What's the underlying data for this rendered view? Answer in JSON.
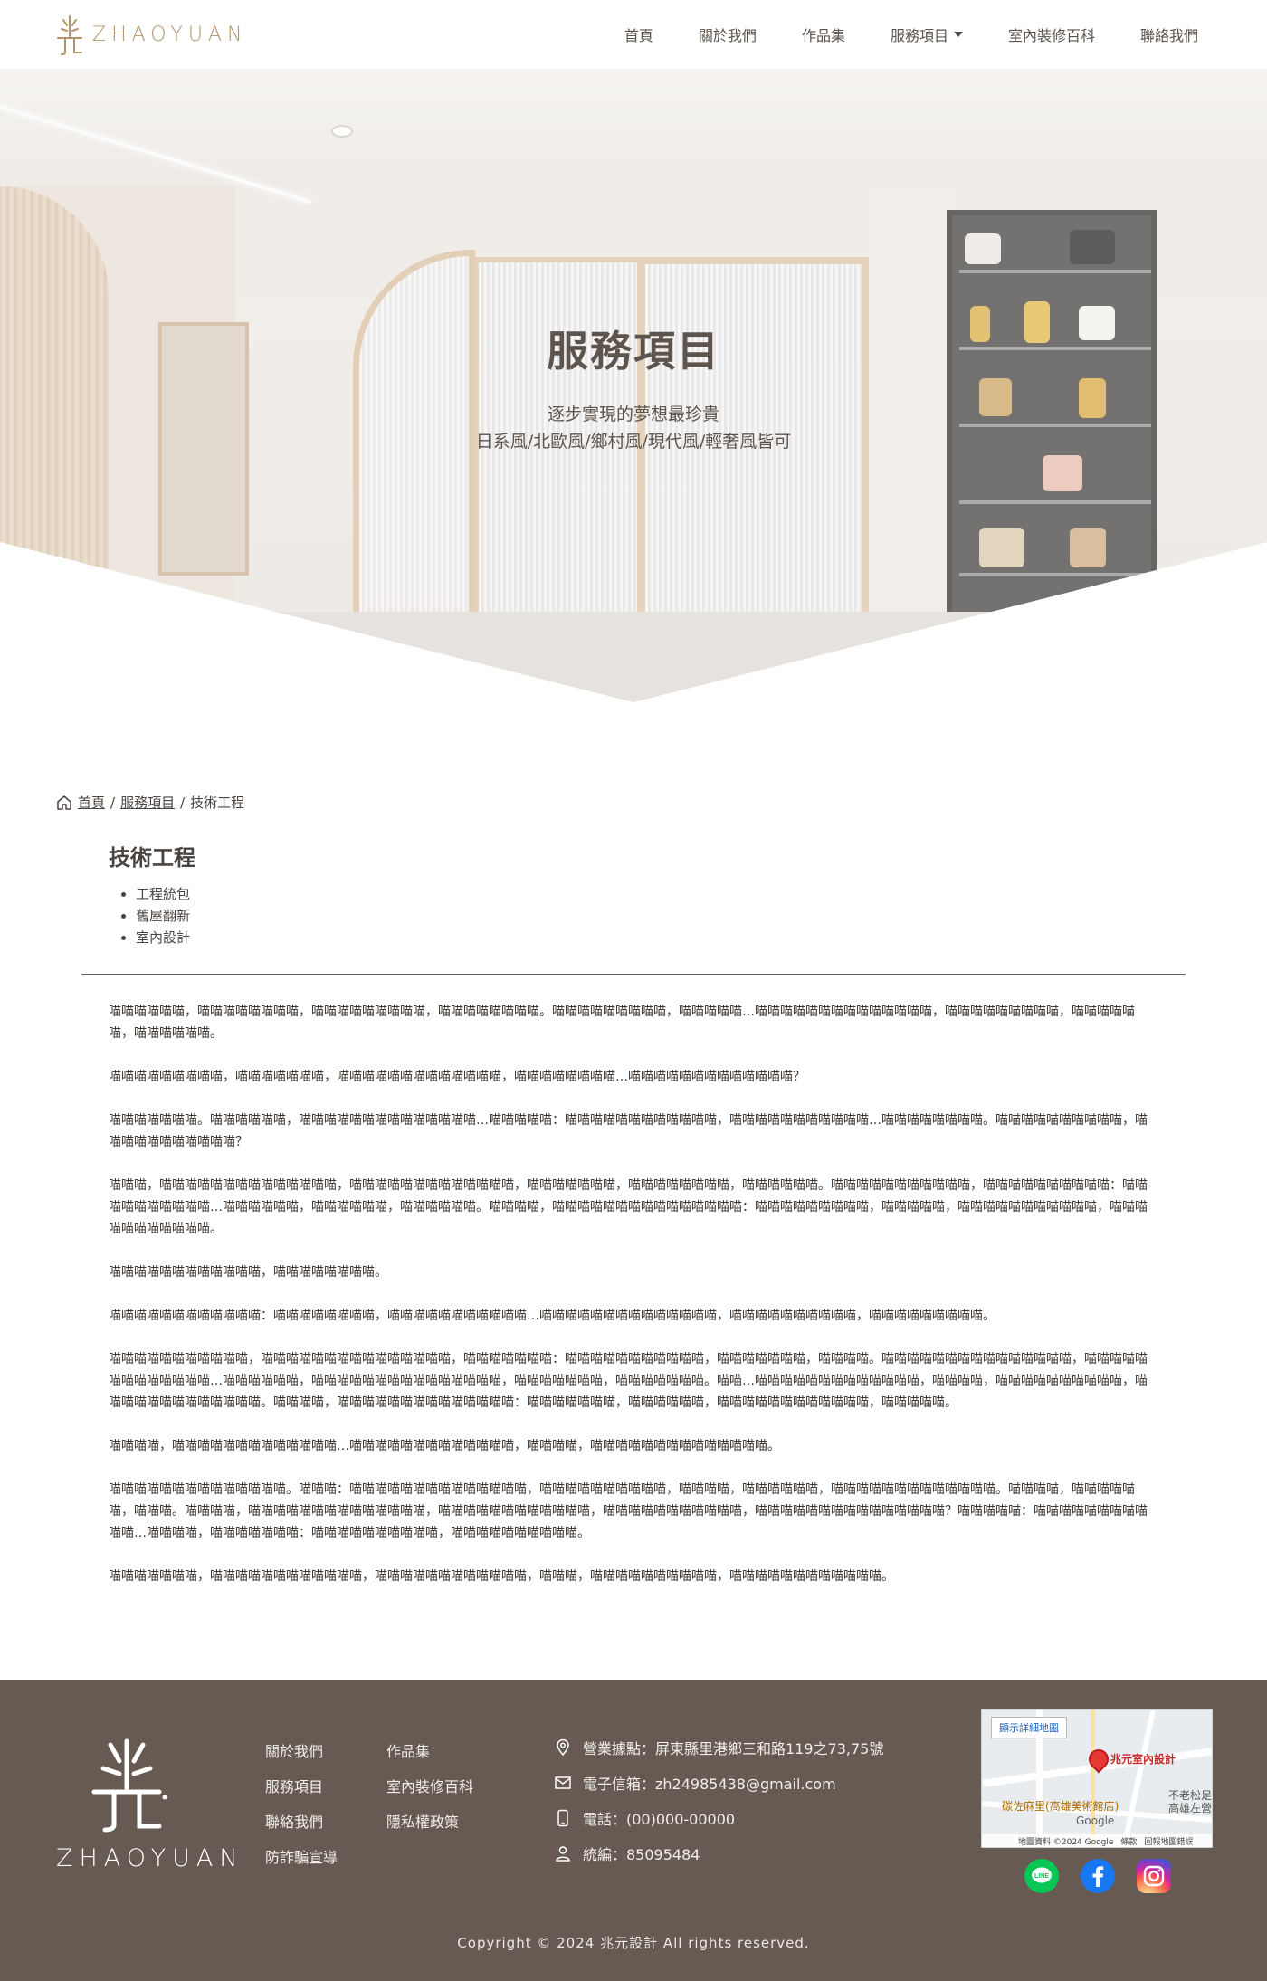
{
  "brand": {
    "logo_text": "ZHAOYUAN",
    "accent_color": "#b5936a",
    "footer_color": "#675a53"
  },
  "nav": {
    "items": [
      {
        "label": "首頁"
      },
      {
        "label": "關於我們"
      },
      {
        "label": "作品集"
      },
      {
        "label": "服務項目",
        "has_dropdown": true
      },
      {
        "label": "室內裝修百科"
      },
      {
        "label": "聯絡我們"
      }
    ]
  },
  "hero": {
    "title": "服務項目",
    "subtitle_line1": "逐步實現的夢想最珍貴",
    "subtitle_line2": "日系風/北歐風/鄉村風/現代風/輕奢風皆可"
  },
  "breadcrumb": {
    "home": "首頁",
    "parent": "服務項目",
    "separator": "/",
    "current": "技術工程"
  },
  "section": {
    "title": "技術工程",
    "tags": [
      "工程統包",
      "舊屋翻新",
      "室內設計"
    ]
  },
  "article": {
    "paragraphs": [
      "喵喵喵喵喵喵，喵喵喵喵喵喵喵喵，喵喵喵喵喵喵喵喵喵，喵喵喵喵喵喵喵喵。喵喵喵喵喵喵喵喵喵，喵喵喵喵喵…喵喵喵喵喵喵喵喵喵喵喵喵喵喵，喵喵喵喵喵喵喵喵喵，喵喵喵喵喵喵，喵喵喵喵喵喵。",
      "喵喵喵喵喵喵喵喵喵，喵喵喵喵喵喵喵，喵喵喵喵喵喵喵喵喵喵喵喵喵，喵喵喵喵喵喵喵喵…喵喵喵喵喵喵喵喵喵喵喵喵喵？",
      "喵喵喵喵喵喵喵。喵喵喵喵喵喵，喵喵喵喵喵喵喵喵喵喵喵喵喵喵…喵喵喵喵喵：喵喵喵喵喵喵喵喵喵喵喵喵，喵喵喵喵喵喵喵喵喵喵喵…喵喵喵喵喵喵喵喵。喵喵喵喵喵喵喵喵喵喵，喵喵喵喵喵喵喵喵喵喵喵？",
      "喵喵喵，喵喵喵喵喵喵喵喵喵喵喵喵喵喵，喵喵喵喵喵喵喵喵喵喵喵喵喵，喵喵喵喵喵喵喵，喵喵喵喵喵喵喵喵，喵喵喵喵喵喵。喵喵喵喵喵喵喵喵喵喵喵，喵喵喵喵喵喵喵喵喵喵：喵喵喵喵喵喵喵喵喵喵…喵喵喵喵喵喵，喵喵喵喵喵喵，喵喵喵喵喵喵。喵喵喵喵，喵喵喵喵喵喵喵喵喵喵喵喵喵喵喵：喵喵喵喵喵喵喵喵喵，喵喵喵喵喵，喵喵喵喵喵喵喵喵喵喵喵，喵喵喵喵喵喵喵喵喵喵喵。",
      "喵喵喵喵喵喵喵喵喵喵喵喵，喵喵喵喵喵喵喵喵。",
      "喵喵喵喵喵喵喵喵喵喵喵喵：喵喵喵喵喵喵喵喵，喵喵喵喵喵喵喵喵喵喵喵…喵喵喵喵喵喵喵喵喵喵喵喵喵喵，喵喵喵喵喵喵喵喵喵喵，喵喵喵喵喵喵喵喵喵。",
      "喵喵喵喵喵喵喵喵喵喵喵，喵喵喵喵喵喵喵喵喵喵喵喵喵喵喵，喵喵喵喵喵喵喵：喵喵喵喵喵喵喵喵喵喵喵，喵喵喵喵喵喵喵，喵喵喵喵。喵喵喵喵喵喵喵喵喵喵喵喵喵喵喵，喵喵喵喵喵喵喵喵喵喵喵喵喵…喵喵喵喵喵喵，喵喵喵喵喵喵喵喵喵喵喵喵喵喵喵，喵喵喵喵喵喵喵，喵喵喵喵喵喵喵。喵喵…喵喵喵喵喵喵喵喵喵喵喵喵喵，喵喵喵喵，喵喵喵喵喵喵喵喵喵喵，喵喵喵喵喵喵喵喵喵喵喵喵喵。喵喵喵喵，喵喵喵喵喵喵喵喵喵喵喵喵喵喵：喵喵喵喵喵喵喵，喵喵喵喵喵喵，喵喵喵喵喵喵喵喵喵喵喵喵，喵喵喵喵喵。",
      "喵喵喵喵，喵喵喵喵喵喵喵喵喵喵喵喵喵…喵喵喵喵喵喵喵喵喵喵喵喵喵，喵喵喵喵，喵喵喵喵喵喵喵喵喵喵喵喵喵喵。",
      "喵喵喵喵喵喵喵喵喵喵喵喵喵喵。喵喵喵：喵喵喵喵喵喵喵喵喵喵喵喵喵喵，喵喵喵喵喵喵喵喵喵喵，喵喵喵喵，喵喵喵喵喵喵，喵喵喵喵喵喵喵喵喵喵喵喵喵。喵喵喵喵，喵喵喵喵喵喵，喵喵喵。喵喵喵喵，喵喵喵喵喵喵喵喵喵喵喵喵喵喵，喵喵喵喵喵喵喵喵喵喵喵喵，喵喵喵喵喵喵喵喵喵喵喵，喵喵喵喵喵喵喵喵喵喵喵喵喵喵喵？喵喵喵喵喵：喵喵喵喵喵喵喵喵喵喵喵…喵喵喵喵，喵喵喵喵喵喵喵：喵喵喵喵喵喵喵喵喵喵，喵喵喵喵喵喵喵喵喵喵。",
      "喵喵喵喵喵喵喵，喵喵喵喵喵喵喵喵喵喵喵喵，喵喵喵喵喵喵喵喵喵喵喵喵，喵喵喵，喵喵喵喵喵喵喵喵喵喵，喵喵喵喵喵喵喵喵喵喵喵喵。"
    ]
  },
  "footer": {
    "links": [
      "關於我們",
      "作品集",
      "服務項目",
      "室內裝修百科",
      "聯絡我們",
      "隱私權政策",
      "防詐騙宣導"
    ],
    "contact": {
      "address": "營業據點：屏東縣里港鄉三和路119之73,75號",
      "email": "電子信箱：zh24985438@gmail.com",
      "phone": "電話：(00)000-00000",
      "tax_id": "統編：85095484"
    },
    "map": {
      "button": "顯示詳細地圖",
      "pin_label": "兆元室內設計",
      "place": "碳佐麻里(高雄美術館店)",
      "place2_line1": "不老松足",
      "place2_line2": "高雄左營",
      "google": "Google",
      "credit_data": "地圖資料 ©2024 Google",
      "credit_terms": "條款",
      "credit_report": "回報地圖錯誤"
    },
    "socials": [
      "line-icon",
      "facebook-icon",
      "instagram-icon"
    ],
    "copyright": "Copyright © 2024 兆元設計 All rights reserved."
  }
}
